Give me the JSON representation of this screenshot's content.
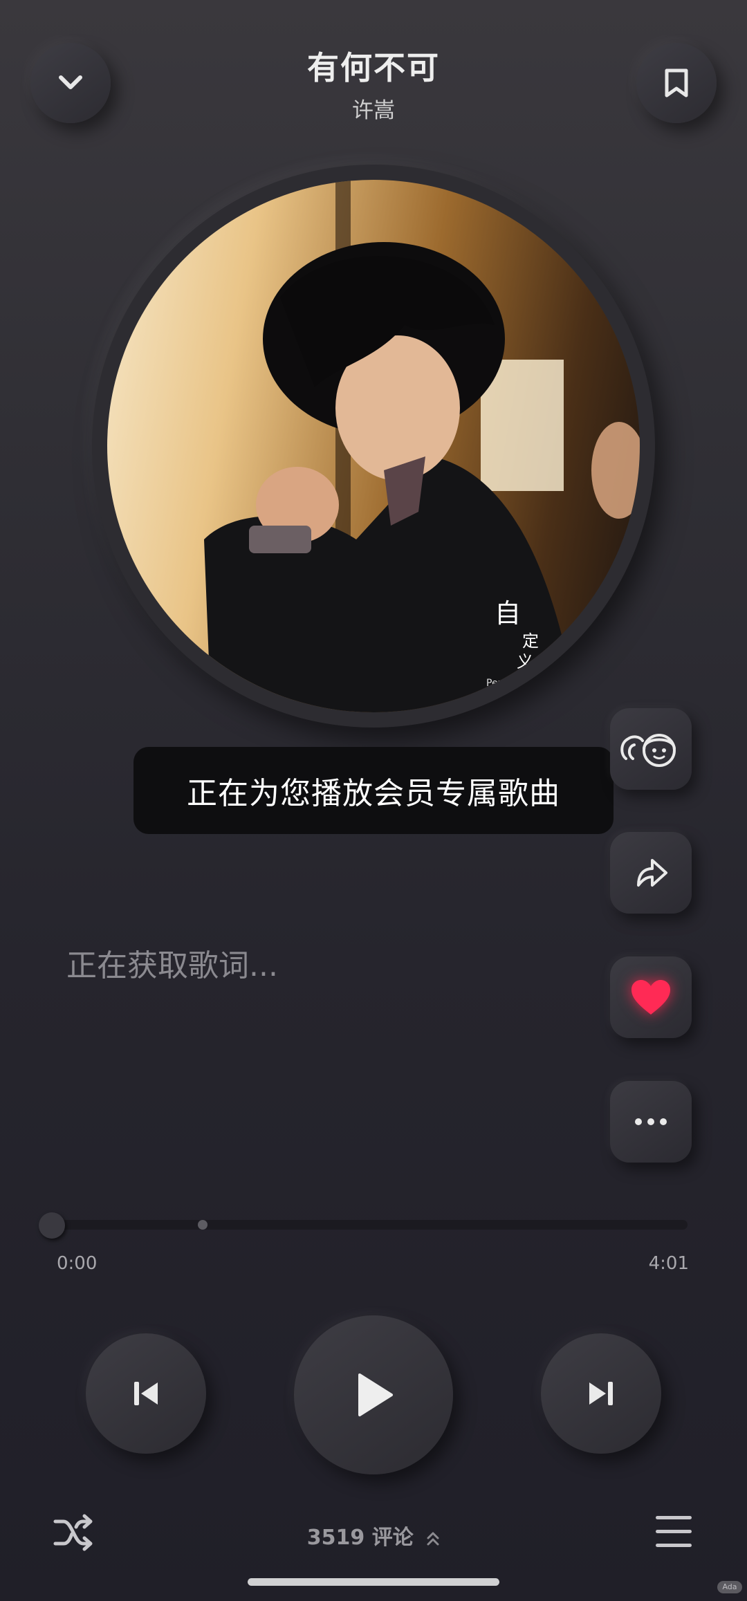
{
  "header": {
    "song_title": "有何不可",
    "artist": "许嵩"
  },
  "cover": {
    "overlay_text_1": "自",
    "overlay_text_2": "定",
    "overlay_text_3": "义",
    "overlay_text_4": "Perso"
  },
  "toast": {
    "message": "正在为您播放会员专属歌曲"
  },
  "lyrics": {
    "status": "正在获取歌词..."
  },
  "player": {
    "progress": 0,
    "buffered": 0.24,
    "current_time": "0:00",
    "total_time": "4:01"
  },
  "side_actions": {
    "items": [
      "listen-together-icon",
      "share-icon",
      "heart-icon",
      "more-icon"
    ],
    "liked": true,
    "heart_color": "#ff2a55"
  },
  "footer": {
    "comments_count": "3519",
    "comments_label": "评论"
  },
  "watermark": "Ada"
}
